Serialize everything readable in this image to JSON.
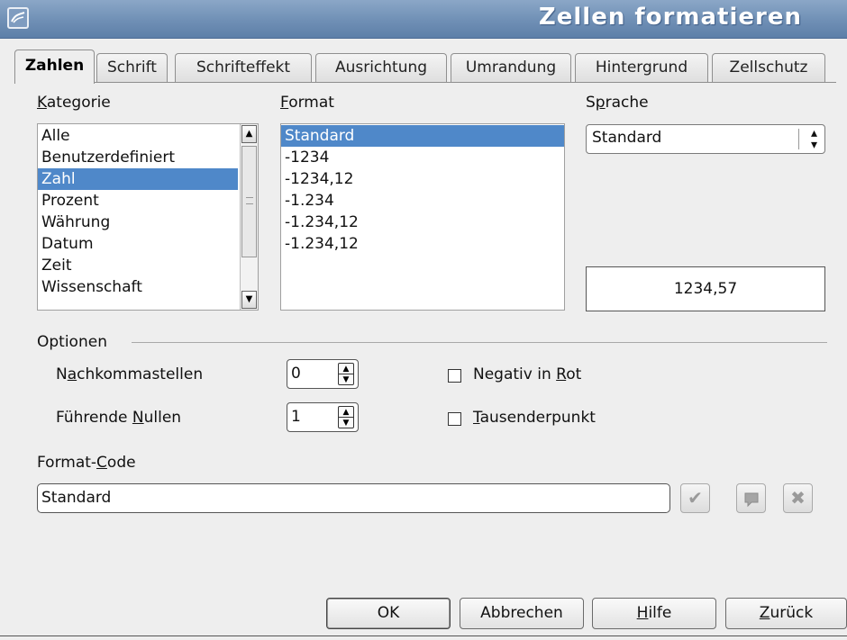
{
  "window": {
    "title": "Zellen formatieren"
  },
  "tabs": [
    {
      "label": "Zahlen",
      "active": true
    },
    {
      "label": "Schrift"
    },
    {
      "label": "Schrifteffekt"
    },
    {
      "label": "Ausrichtung"
    },
    {
      "label": "Umrandung"
    },
    {
      "label": "Hintergrund"
    },
    {
      "label": "Zellschutz"
    }
  ],
  "kategorie": {
    "label_mnemonic": "K",
    "label_rest": "ategorie",
    "items": [
      "Alle",
      "Benutzerdefiniert",
      "Zahl",
      "Prozent",
      "Währung",
      "Datum",
      "Zeit",
      "Wissenschaft"
    ],
    "selected": "Zahl"
  },
  "format": {
    "label_mnemonic": "F",
    "label_rest": "ormat",
    "items": [
      "Standard",
      "-1234",
      "-1234,12",
      "-1.234",
      "-1.234,12",
      "-1.234,12"
    ],
    "selected": "Standard"
  },
  "sprache": {
    "label_pre": "S",
    "label_mnemonic": "p",
    "label_rest": "rache",
    "value": "Standard"
  },
  "preview": {
    "value": "1234,57"
  },
  "optionen": {
    "label": "Optionen",
    "nachkomma": {
      "label_pre": "N",
      "label_mnemonic": "a",
      "label_rest": "chkommastellen",
      "value": "0"
    },
    "nullen": {
      "label_pre": "Führende ",
      "label_mnemonic": "N",
      "label_rest": "ullen",
      "value": "1"
    },
    "negativ": {
      "label_pre": "Negativ in ",
      "label_mnemonic": "R",
      "label_rest": "ot",
      "checked": false
    },
    "tausender": {
      "label_pre": "",
      "label_mnemonic": "T",
      "label_rest": "ausenderpunkt",
      "checked": false
    }
  },
  "format_code": {
    "label_pre": "Format-",
    "label_mnemonic": "C",
    "label_rest": "ode",
    "value": "Standard"
  },
  "buttons": {
    "ok": "OK",
    "abbrechen": "Abbrechen",
    "hilfe_mnemonic": "H",
    "hilfe_rest": "ilfe",
    "zurueck_mnemonic": "Z",
    "zurueck_rest": "urück"
  },
  "icons": {
    "title": "office-app-icon",
    "scroll_up": "arrow-up-icon",
    "scroll_down": "arrow-down-icon",
    "accept": "checkmark-icon",
    "comment": "comment-icon",
    "delete": "delete-x-icon"
  },
  "colors": {
    "selection": "#4f88c9",
    "titlebar": "#6f8fb5"
  }
}
